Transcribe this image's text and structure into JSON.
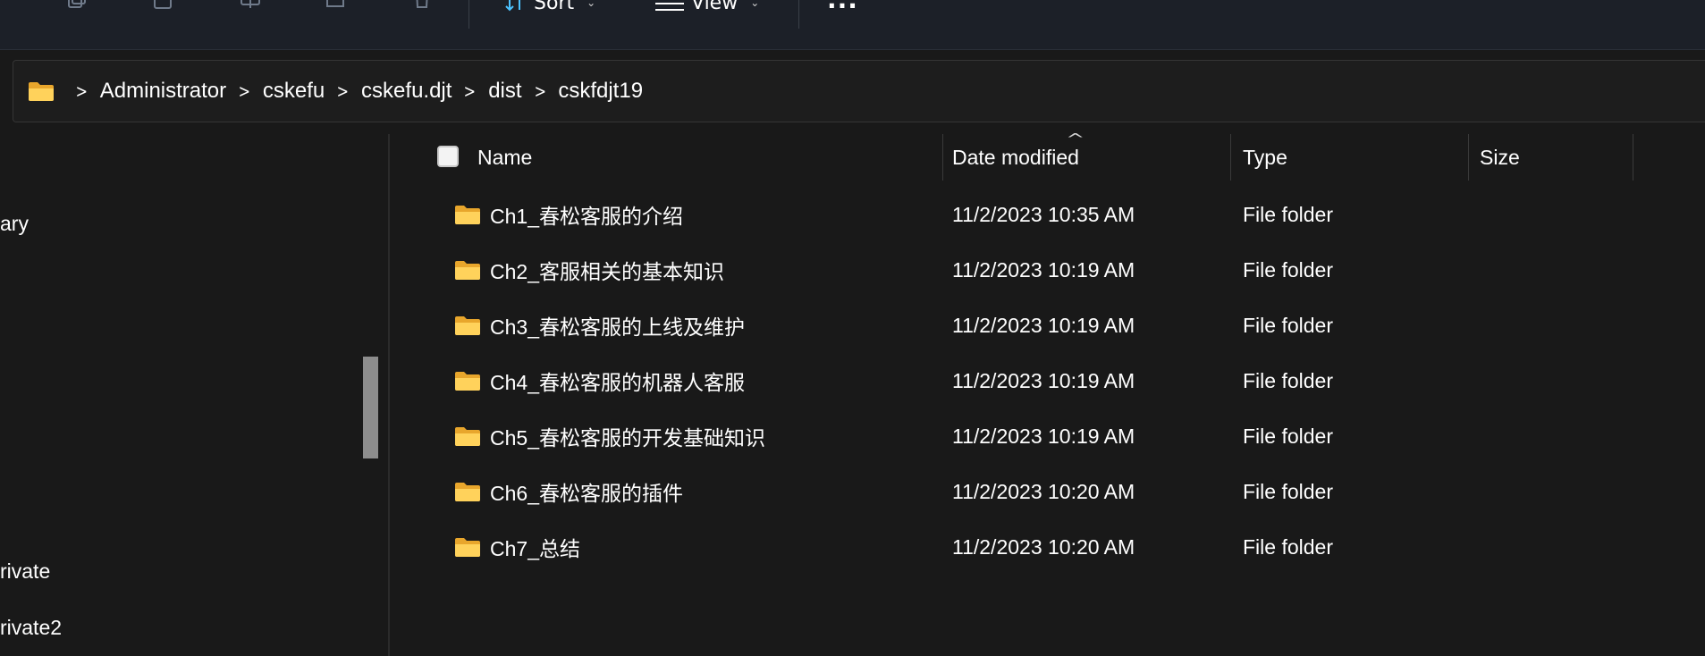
{
  "toolbar": {
    "icons": [
      "copy-icon",
      "paste-icon",
      "rename-icon",
      "share-icon",
      "delete-icon"
    ],
    "sort_label": "Sort",
    "view_label": "View",
    "more_label": "···"
  },
  "address": {
    "crumbs": [
      "Administrator",
      "cskefu",
      "cskefu.djt",
      "dist",
      "cskfdjt19"
    ]
  },
  "nav": {
    "items": [
      "ary",
      "rivate",
      "rivate2"
    ]
  },
  "columns": {
    "name": "Name",
    "date": "Date modified",
    "type": "Type",
    "size": "Size"
  },
  "files": [
    {
      "name": "Ch1_春松客服的介绍",
      "date": "11/2/2023 10:35 AM",
      "type": "File folder"
    },
    {
      "name": "Ch2_客服相关的基本知识",
      "date": "11/2/2023 10:19 AM",
      "type": "File folder"
    },
    {
      "name": "Ch3_春松客服的上线及维护",
      "date": "11/2/2023 10:19 AM",
      "type": "File folder"
    },
    {
      "name": "Ch4_春松客服的机器人客服",
      "date": "11/2/2023 10:19 AM",
      "type": "File folder"
    },
    {
      "name": "Ch5_春松客服的开发基础知识",
      "date": "11/2/2023 10:19 AM",
      "type": "File folder"
    },
    {
      "name": "Ch6_春松客服的插件",
      "date": "11/2/2023 10:20 AM",
      "type": "File folder"
    },
    {
      "name": "Ch7_总结",
      "date": "11/2/2023 10:20 AM",
      "type": "File folder"
    }
  ],
  "colors": {
    "folder": "#ffd25b",
    "folder_dark": "#e8a62c",
    "accent": "#4cc2ff"
  }
}
